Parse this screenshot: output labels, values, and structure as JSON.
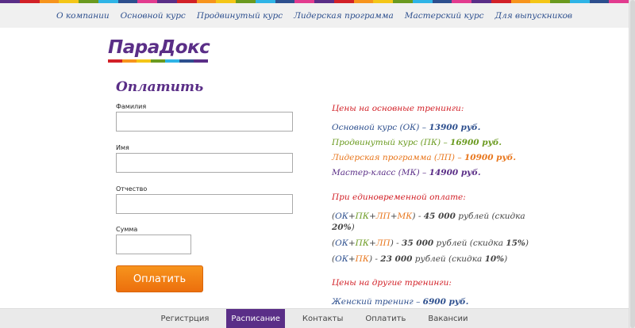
{
  "rainbow_colors": [
    "#5a2e87",
    "#d22027",
    "#f7941d",
    "#f4c617",
    "#6a9a1f",
    "#2fb4e6",
    "#2d4f8e",
    "#e23b8f",
    "#5a2e87",
    "#d22027",
    "#f7941d",
    "#f4c617",
    "#6a9a1f",
    "#2fb4e6",
    "#2d4f8e",
    "#e23b8f",
    "#5a2e87",
    "#d22027",
    "#f7941d",
    "#f4c617",
    "#6a9a1f",
    "#2fb4e6",
    "#2d4f8e",
    "#e23b8f",
    "#5a2e87",
    "#d22027",
    "#f7941d",
    "#f4c617",
    "#6a9a1f",
    "#2fb4e6",
    "#2d4f8e",
    "#e23b8f"
  ],
  "top_nav": [
    {
      "label": "О компании"
    },
    {
      "label": "Основной курс"
    },
    {
      "label": "Продвинутый курс"
    },
    {
      "label": "Лидерская программа"
    },
    {
      "label": "Мастерский курс"
    },
    {
      "label": "Для выпускников"
    }
  ],
  "logo": {
    "text": "ПараДокс",
    "bar_colors": [
      "#d22027",
      "#f7941d",
      "#f4c617",
      "#6a9a1f",
      "#2fb4e6",
      "#2d4f8e",
      "#5a2e87"
    ]
  },
  "form": {
    "title": "Оплатить",
    "fields": [
      {
        "label": "Фамилия",
        "value": ""
      },
      {
        "label": "Имя",
        "value": ""
      },
      {
        "label": "Отчество",
        "value": ""
      },
      {
        "label": "Сумма",
        "value": ""
      }
    ],
    "submit_label": "Оплатить"
  },
  "prices": {
    "heading_main": "Цены на основные тренинги:",
    "main": [
      {
        "name": "Основной курс (ОК) – ",
        "price": "13900 руб."
      },
      {
        "name": "Продвинутый курс (ПК) – ",
        "price": "16900 руб."
      },
      {
        "name": "Лидерская программа (ЛП) – ",
        "price": "10900 руб."
      },
      {
        "name": "Мастер-класс (МК) – ",
        "price": "14900 руб."
      }
    ],
    "heading_bundle": "При единовременной оплате:",
    "bundle1": {
      "ok": "ОК",
      "pk": "ПК",
      "lp": "ЛП",
      "mk": "МК",
      "price": "45 000",
      "text_a": " рублей (скидка",
      "discount": "20%"
    },
    "bundle2": {
      "ok": "ОК",
      "pk": "ПК",
      "lp": "ЛП",
      "price": "35 000",
      "text_a": " рублей (скидка ",
      "discount": "15%"
    },
    "bundle3": {
      "ok": "ОК",
      "pk": "ПК",
      "price": "23 000",
      "text_a": " рублей (скидка ",
      "discount": "10%"
    },
    "heading_other": "Цены на другие тренинги:",
    "other": [
      {
        "name": "Женский тренинг – ",
        "price": "6900 руб."
      }
    ]
  },
  "bottom_nav": [
    {
      "label": "Регистрция",
      "active": false
    },
    {
      "label": "Расписание",
      "active": true
    },
    {
      "label": "Контакты",
      "active": false
    },
    {
      "label": "Оплатить",
      "active": false
    },
    {
      "label": "Вакансии",
      "active": false
    }
  ]
}
